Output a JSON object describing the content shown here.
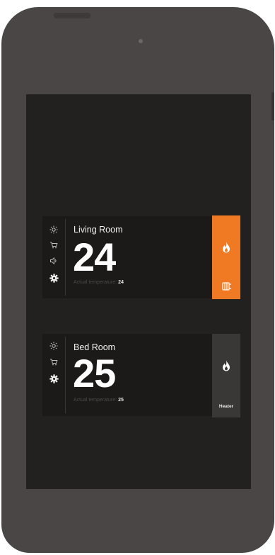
{
  "rooms": [
    {
      "name": "Living Room",
      "set_temperature": "24",
      "actual_label": "Actual temperature:",
      "actual_value": "24",
      "mode_active": true,
      "icons": [
        "sun-icon",
        "cart-icon",
        "speaker-icon",
        "gear-icon"
      ]
    },
    {
      "name": "Bed Room",
      "set_temperature": "25",
      "actual_label": "Actual temperature:",
      "actual_value": "25",
      "mode_active": false,
      "heater_label": "Heater",
      "icons": [
        "sun-icon",
        "cart-icon",
        "gear-icon"
      ]
    }
  ],
  "colors": {
    "accent": "#f07a23",
    "panel_inactive": "#3a3837",
    "screen_bg": "#222120",
    "card_bg": "#1b1a19",
    "phone_body": "#4a4645"
  }
}
